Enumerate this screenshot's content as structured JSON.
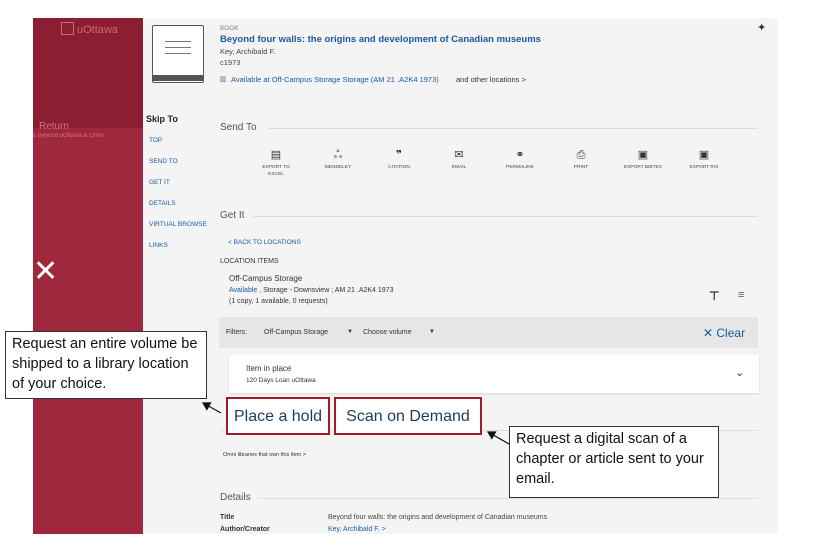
{
  "left_panel": {
    "logo_text": "uOttawa",
    "faded_line1": "Return",
    "faded_line2": "s Beyond uOttawa & Omni",
    "close_glyph": "✕"
  },
  "record": {
    "type": "BOOK",
    "title": "Beyond four walls: the origins and development of Canadian museums",
    "author": "Key, Archibald F.",
    "date": "c1973",
    "availability": "Available at Off-Campus Storage  Storage (AM 21 .A2K4 1973)",
    "other_locations": "and other locations  >"
  },
  "skip_to": {
    "title": "Skip To",
    "links": [
      "TOP",
      "SEND TO",
      "GET IT",
      "DETAILS",
      "VIRTUAL BROWSE",
      "LINKS"
    ]
  },
  "send_to": {
    "heading": "Send To",
    "actions": [
      {
        "label": "EXPORT TO EXCEL",
        "icon": "excel-icon",
        "glyph": "▤"
      },
      {
        "label": "MENDELEY",
        "icon": "mendeley-icon",
        "glyph": "ஃ"
      },
      {
        "label": "CITATION",
        "icon": "quote-icon",
        "glyph": "❞"
      },
      {
        "label": "EMAIL",
        "icon": "email-icon",
        "glyph": "✉"
      },
      {
        "label": "PERMALINK",
        "icon": "link-icon",
        "glyph": "⚭"
      },
      {
        "label": "PRINT",
        "icon": "print-icon",
        "glyph": "⎙"
      },
      {
        "label": "EXPORT BIBTEX",
        "icon": "bibtex-icon",
        "glyph": "▣"
      },
      {
        "label": "EXPORT RIS",
        "icon": "ris-icon",
        "glyph": "▣"
      }
    ]
  },
  "get_it": {
    "heading": "Get It",
    "back_link": "<  BACK TO LOCATIONS",
    "location_items_label": "LOCATION ITEMS",
    "location_name": "Off-Campus Storage",
    "status_available": "Available",
    "status_rest": " , Storage - Downsview ; AM 21 .A2K4 1973",
    "copies": "(1 copy, 1 available, 0 requests)",
    "filters_label": "Filters:",
    "filter_value": "Off-Campus Storage",
    "volume_placeholder": "Choose volume",
    "clear_label": "✕ Clear",
    "item_status": "Item in place",
    "item_policy": "120 Days Loan uOttawa",
    "place_hold": "Place a hold",
    "scan_on_demand": "Scan on Demand",
    "omni_link": "Omni libraries that own this item  >"
  },
  "details": {
    "heading": "Details",
    "title_label": "Title",
    "title_value": "Beyond four walls: the origins and development of Canadian museums",
    "author_label": "Author/Creator",
    "author_value": "Key, Archibald F.  >"
  },
  "callouts": {
    "left": "Request an entire volume be shipped to a library location of your choice.",
    "right": "Request a digital scan of a chapter or article sent to your email."
  },
  "colors": {
    "panel": "#a0283d",
    "highlight_border": "#a01a2e",
    "link": "#1a5aa5"
  }
}
